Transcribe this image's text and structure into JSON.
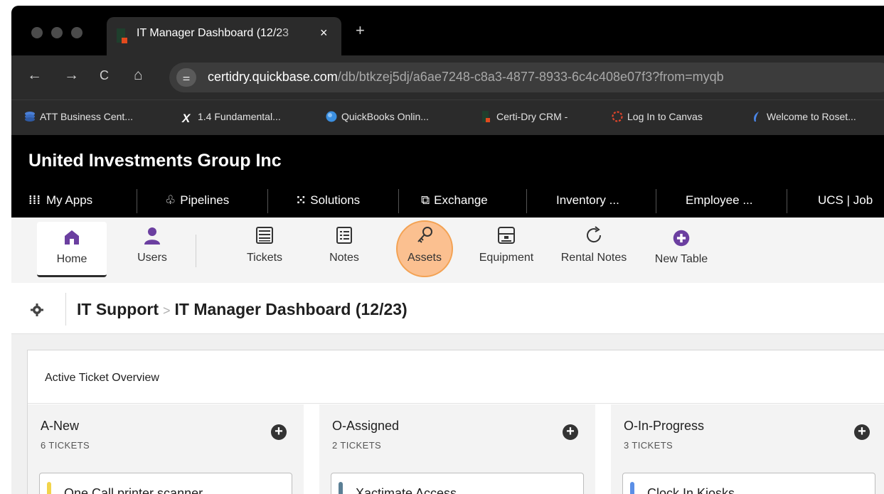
{
  "browser": {
    "tab": {
      "title": "IT Manager Dashboard (12/23",
      "close": "×"
    },
    "new_tab": "+",
    "nav": {
      "back": "←",
      "forward": "→",
      "reload": "C",
      "home": "⌂"
    },
    "site_info": "⚌",
    "url_host": "certidry.quickbase.com",
    "url_path": "/db/btkzej5dj/a6ae7248-c8a3-4877-8933-6c4c408e07f3?from=myqb",
    "bookmarks": [
      {
        "label": "ATT Business Cent...",
        "icon": "stack-icon",
        "color": "#4a7fd6"
      },
      {
        "label": "1.4 Fundamental...",
        "icon": "x-logo-icon",
        "glyph": "X"
      },
      {
        "label": "QuickBooks Onlin...",
        "icon": "circle-icon",
        "color": "#3b8fe0"
      },
      {
        "label": "Certi-Dry CRM -",
        "icon": "quickbase-icon"
      },
      {
        "label": "Log In to Canvas",
        "icon": "canvas-icon",
        "color": "#e0442b"
      },
      {
        "label": "Welcome to Roset...",
        "icon": "feather-icon",
        "color": "#4a86e8"
      }
    ]
  },
  "app": {
    "title": "United Investments Group Inc",
    "nav": [
      {
        "label": "My Apps",
        "icon": "grid-icon",
        "glyph": "⁞⁞⁞"
      },
      {
        "label": "Pipelines",
        "icon": "pipelines-icon",
        "glyph": "♧"
      },
      {
        "label": "Solutions",
        "icon": "solutions-icon",
        "glyph": "⁙"
      },
      {
        "label": "Exchange",
        "icon": "exchange-icon",
        "glyph": "⧉"
      },
      {
        "label": "Inventory ...",
        "icon": ""
      },
      {
        "label": "Employee ...",
        "icon": ""
      },
      {
        "label": "UCS | Job",
        "icon": ""
      }
    ]
  },
  "tables": [
    {
      "label": "Home",
      "icon": "home-icon",
      "selected": true
    },
    {
      "label": "Users",
      "icon": "user-icon"
    },
    {
      "label": "Tickets",
      "icon": "ticket-list-icon"
    },
    {
      "label": "Notes",
      "icon": "notes-icon"
    },
    {
      "label": "Assets",
      "icon": "key-icon",
      "highlighted": true
    },
    {
      "label": "Equipment",
      "icon": "equipment-icon"
    },
    {
      "label": "Rental Notes",
      "icon": "refresh-icon"
    },
    {
      "label": "New Table",
      "icon": "plus-circle-icon"
    }
  ],
  "page": {
    "breadcrumb_parent": "IT Support",
    "breadcrumb_sep": ">",
    "title": "IT Manager Dashboard (12/23)"
  },
  "dashboard": {
    "panel_title": "Active Ticket Overview",
    "columns": [
      {
        "name": "A-New",
        "count": "6 TICKETS",
        "first_card": "One Call printer scanner",
        "card_color": "#f2d44b"
      },
      {
        "name": "O-Assigned",
        "count": "2 TICKETS",
        "first_card": "Xactimate Access",
        "card_color": "#5b7f95"
      },
      {
        "name": "O-In-Progress",
        "count": "3 TICKETS",
        "first_card": "Clock In Kiosks",
        "card_color": "#5b8fe6"
      }
    ],
    "add_glyph": "+"
  },
  "colors": {
    "accent_purple": "#6b3fa0",
    "assets_highlight": "#f3a253"
  }
}
